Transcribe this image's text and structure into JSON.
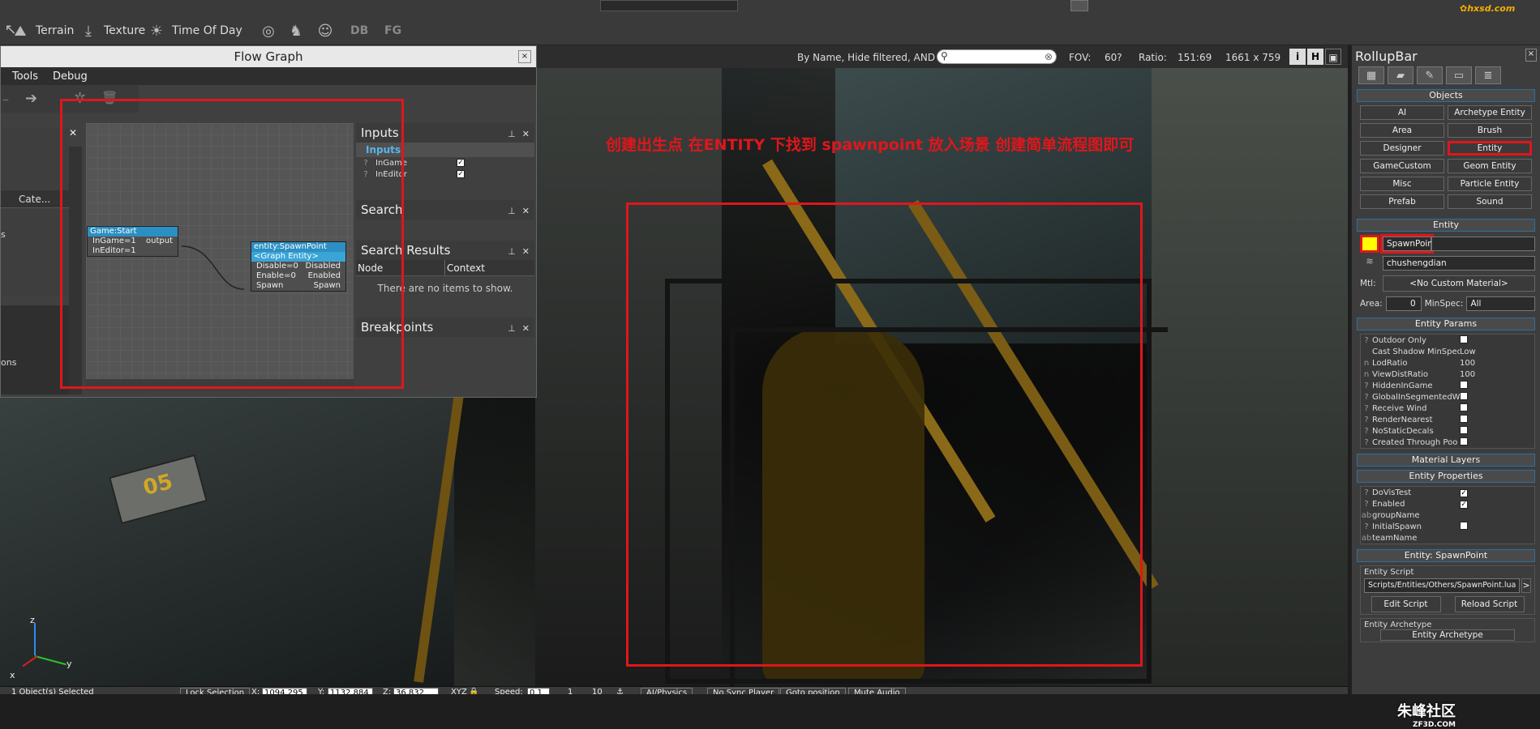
{
  "toolbar": {
    "terrain": "Terrain",
    "texture": "Texture",
    "time_of_day": "Time Of Day",
    "db": "DB",
    "fg": "FG"
  },
  "viewport": {
    "filter": "By Name, Hide filtered, AND",
    "search_placeholder": "",
    "fov_label": "FOV:",
    "fov_value": "60?",
    "ratio_label": "Ratio:",
    "ratio_value": "151:69",
    "resolution": "1661 x 759",
    "annotation": "创建出生点 在ENTITY 下找到 spawnpoint  放入场景  创建简单流程图即可",
    "axis_z": "z",
    "axis_y": "y",
    "axis_x": "x",
    "sign": "05"
  },
  "flowgraph": {
    "title": "Flow Graph",
    "menu": [
      "Tools",
      "Debug"
    ],
    "col_cate": "Cate...",
    "side_s": "s",
    "side_ons": "ons",
    "node1": {
      "title": "Game:Start",
      "in1": "InGame=1",
      "in2": "InEditor=1",
      "out": "output"
    },
    "node2": {
      "title": "entity:SpawnPoint",
      "sub": "<Graph Entity>",
      "r1l": "Disable=0",
      "r1r": "Disabled",
      "r2l": "Enable=0",
      "r2r": "Enabled",
      "r3l": "Spawn",
      "r3r": "Spawn"
    },
    "inputs": {
      "title": "Inputs",
      "sub": "Inputs",
      "rows": [
        "InGame",
        "InEditor"
      ]
    },
    "search": {
      "title": "Search"
    },
    "search_results": {
      "title": "Search Results",
      "col_node": "Node",
      "col_context": "Context",
      "empty": "There are no items to show."
    },
    "breakpoints": {
      "title": "Breakpoints"
    }
  },
  "rollup": {
    "title": "RollupBar",
    "objects_header": "Objects",
    "object_buttons": [
      "AI",
      "Archetype Entity",
      "Area",
      "Brush",
      "Designer",
      "Entity",
      "GameCustom",
      "Geom Entity",
      "Misc",
      "Particle Entity",
      "Prefab",
      "Sound"
    ],
    "entity_header": "Entity",
    "entity_name": "SpawnPoint1",
    "layer_name": "chushengdian",
    "mtl_label": "Mtl:",
    "mtl_value": "<No Custom Material>",
    "area_label": "Area:",
    "area_value": "0",
    "minspec_label": "MinSpec:",
    "minspec_value": "All",
    "params_header": "Entity Params",
    "params": [
      {
        "q": "?",
        "n": "Outdoor Only",
        "v": "chk"
      },
      {
        "q": "",
        "n": "Cast Shadow MinSpec",
        "v": "Low"
      },
      {
        "q": "n",
        "n": "LodRatio",
        "v": "100"
      },
      {
        "q": "n",
        "n": "ViewDistRatio",
        "v": "100"
      },
      {
        "q": "?",
        "n": "HiddenInGame",
        "v": "chk"
      },
      {
        "q": "?",
        "n": "GlobalInSegmentedW",
        "v": "chk"
      },
      {
        "q": "?",
        "n": "Receive Wind",
        "v": "chk"
      },
      {
        "q": "?",
        "n": "RenderNearest",
        "v": "chk"
      },
      {
        "q": "?",
        "n": "NoStaticDecals",
        "v": "chk"
      },
      {
        "q": "?",
        "n": "Created Through Poo",
        "v": "chk"
      }
    ],
    "material_layers": "Material Layers",
    "props_header": "Entity Properties",
    "props": [
      {
        "q": "?",
        "n": "DoVisTest",
        "v": "on"
      },
      {
        "q": "?",
        "n": "Enabled",
        "v": "on"
      },
      {
        "q": "ab",
        "n": "groupName",
        "v": ""
      },
      {
        "q": "?",
        "n": "InitialSpawn",
        "v": "chk"
      },
      {
        "q": "ab",
        "n": "teamName",
        "v": ""
      }
    ],
    "spawn_header": "Entity: SpawnPoint",
    "script_label": "Entity Script",
    "script_path": "Scripts/Entities/Others/SpawnPoint.lua",
    "edit_script": "Edit Script",
    "reload_script": "Reload Script",
    "archetype_label": "Entity Archetype",
    "archetype_btn": "Entity Archetype"
  },
  "statusbar": {
    "selected": "1 Object(s) Selected",
    "lock": "Lock Selection",
    "x_label": "X:",
    "x_val": "1094.295",
    "y_label": "Y:",
    "y_val": "1132.884",
    "z_label": "Z:",
    "z_val": "36.832",
    "xyz": "XYZ",
    "speed_label": "Speed:",
    "speed_val": "0.1",
    "s1": "1",
    "s2": "10",
    "ai_physics": "AI/Physics",
    "no_sync": "No Sync Player",
    "goto": "Goto position",
    "mute": "Mute Audio"
  },
  "watermark": {
    "top": "hxsd.com",
    "bottom_cn": "朱峰社区",
    "bottom_en": "ZF3D.COM"
  }
}
